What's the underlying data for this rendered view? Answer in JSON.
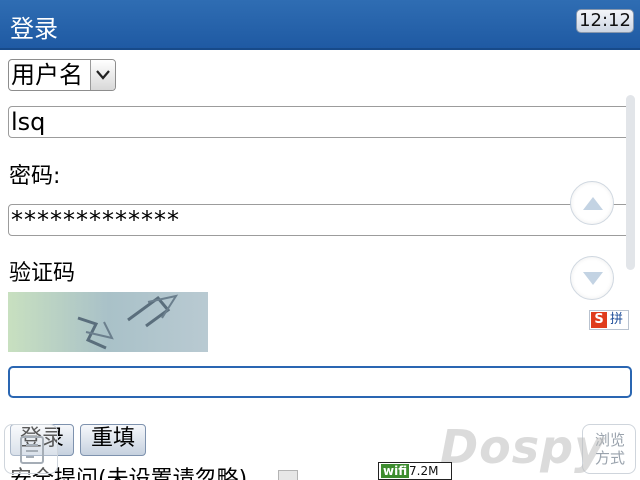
{
  "titlebar": {
    "title": "登录",
    "clock": "12:12"
  },
  "form": {
    "account_type": {
      "selected": "用户名"
    },
    "username": {
      "value": "lsq"
    },
    "password": {
      "label": "密码:",
      "value": "*************"
    },
    "captcha": {
      "label": "验证码",
      "value": ""
    },
    "buttons": {
      "login": "登录",
      "reset": "重填"
    },
    "bottom_option": "安全提问(未设置请忽略)"
  },
  "ime": {
    "logo": "S",
    "mode": "拼"
  },
  "softkeys": {
    "right": "浏览 方式"
  },
  "overlay": {
    "watermark": "Dospy",
    "wifi_logo": "wifi",
    "wifi_speed": "7.2M"
  },
  "colors": {
    "titlebar": "#1f5aa3",
    "accent": "#2a66b2"
  }
}
